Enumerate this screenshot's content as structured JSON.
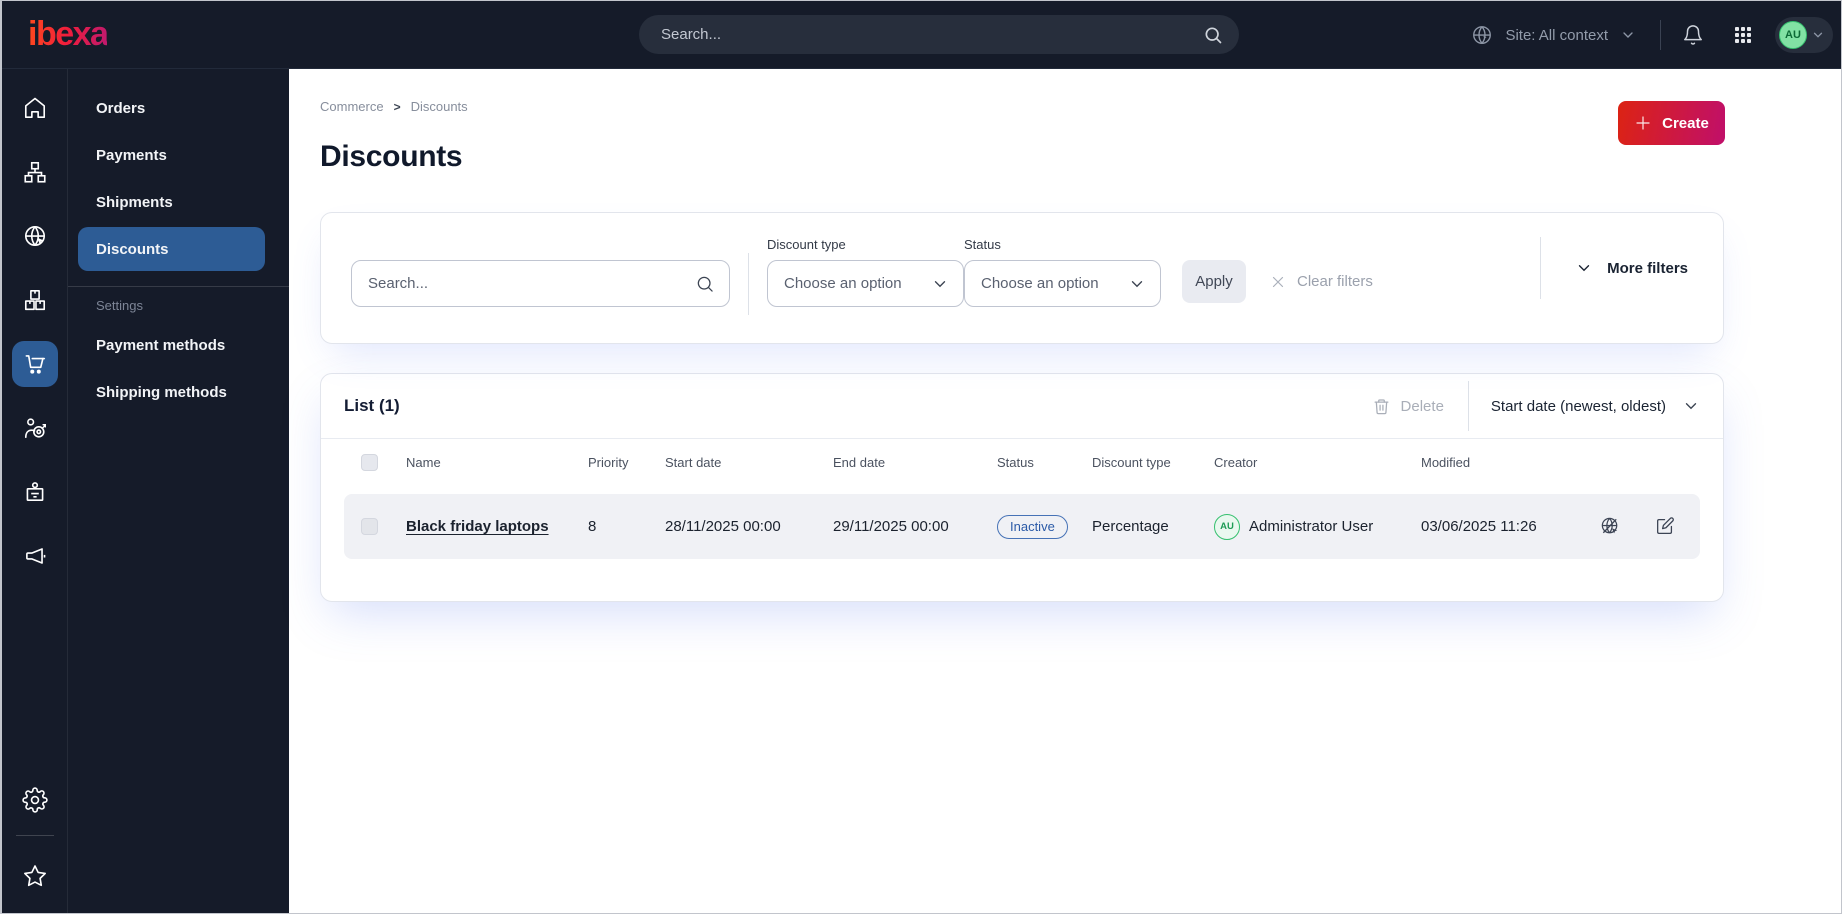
{
  "topbar": {
    "logo_text": "ibexa",
    "search_placeholder": "Search...",
    "site_label": "Site: All context"
  },
  "rail": {
    "icons": [
      "home",
      "content-tree",
      "site",
      "product-catalog",
      "commerce",
      "customer-experience",
      "members",
      "promotions",
      "settings",
      "bookmarks"
    ],
    "active": "commerce"
  },
  "sidebar": {
    "items": [
      {
        "label": "Orders"
      },
      {
        "label": "Payments"
      },
      {
        "label": "Shipments"
      },
      {
        "label": "Discounts",
        "active": true
      }
    ],
    "section_label": "Settings",
    "section_items": [
      {
        "label": "Payment methods"
      },
      {
        "label": "Shipping methods"
      }
    ]
  },
  "breadcrumb": {
    "items": [
      "Commerce",
      "Discounts"
    ],
    "separator": ">"
  },
  "page": {
    "title": "Discounts",
    "create_label": "Create"
  },
  "filters": {
    "search_placeholder": "Search...",
    "discount_type_label": "Discount type",
    "status_label": "Status",
    "choose_option_label": "Choose an option",
    "apply_label": "Apply",
    "clear_filters_label": "Clear filters",
    "more_filters_label": "More filters"
  },
  "list": {
    "title": "List (1)",
    "delete_label": "Delete",
    "sort_label": "Start date (newest, oldest)",
    "columns": [
      "Name",
      "Priority",
      "Start date",
      "End date",
      "Status",
      "Discount type",
      "Creator",
      "Modified"
    ],
    "rows": [
      {
        "name": "Black friday laptops",
        "priority": "8",
        "start_date": "28/11/2025 00:00",
        "end_date": "29/11/2025 00:00",
        "status": "Inactive",
        "discount_type": "Percentage",
        "creator_initials": "AU",
        "creator": "Administrator User",
        "modified": "03/06/2025 11:26"
      }
    ]
  },
  "user": {
    "initials": "AU"
  },
  "colors": {
    "topbar_bg": "#151b29",
    "accent_blue": "#2d5c95",
    "brand_gradient_start": "#dc2313",
    "brand_gradient_end": "#c00f6a",
    "badge_border": "#4672b6",
    "badge_text": "#2b5aa7",
    "avatar_green": "#35c06e",
    "row_bg": "#f0f1f5"
  }
}
